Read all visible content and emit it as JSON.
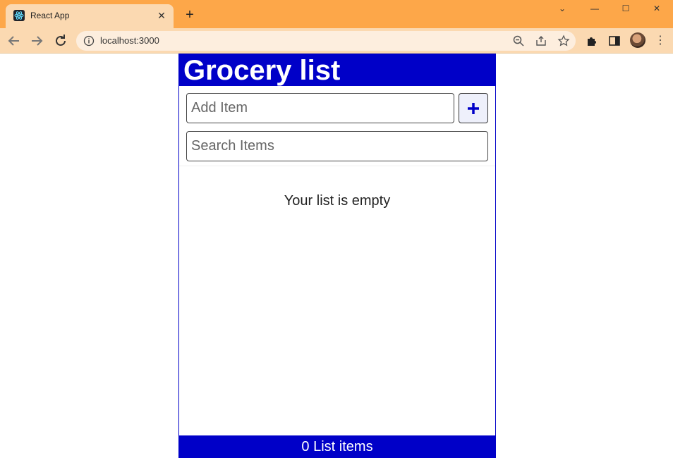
{
  "browser": {
    "tab_title": "React App",
    "tab_close": "✕",
    "new_tab": "+",
    "url": "localhost:3000",
    "window_controls": {
      "minimize": "—",
      "maximize": "☐",
      "close": "✕"
    },
    "collapse": "⌄"
  },
  "app": {
    "title": "Grocery list",
    "add_placeholder": "Add Item",
    "add_button_icon": "plus-icon",
    "search_placeholder": "Search Items",
    "empty_message": "Your list is empty",
    "footer_text": "0 List items"
  },
  "colors": {
    "brand": "#0000c8",
    "browser_frame": "#fda749",
    "toolbar": "#fbd9b1"
  }
}
